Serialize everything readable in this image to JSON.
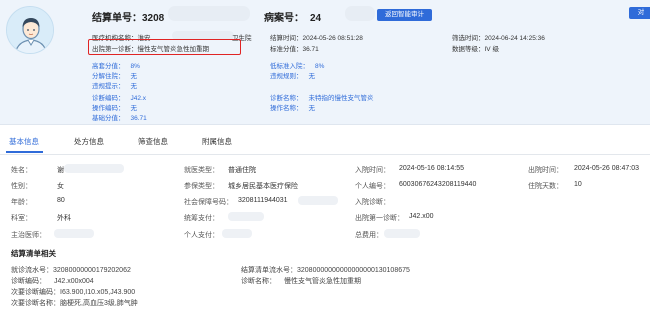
{
  "header": {
    "settle_no_label": "结算单号：",
    "settle_no_value": "3208",
    "case_no_label": "病案号：",
    "case_no_value": "24",
    "return_button": "返回智能审计",
    "right_button_fragment": "对",
    "institution_label": "医疗机构名称：",
    "institution_value": "淮安",
    "institution_suffix": "卫生院",
    "settle_time_label": "结算时间：",
    "settle_time_value": "2024-05-26 08:51:28",
    "filter_time_label": "筛选时间：",
    "filter_time_value": "2024-06-24 14:25:36",
    "discharge_diag_label": "出院第一诊断：",
    "discharge_diag_value": "慢性支气管炎急性加重期",
    "std_score_label": "标准分值：",
    "std_score_value": "36.71",
    "data_level_label": "数据等级：",
    "data_level_value": "IV 级",
    "high_score_label": "高套分值：",
    "high_score_value": "8%",
    "low_standard_label": "低标准入院：",
    "low_standard_value": "8%",
    "split_label": "分解住院：",
    "split_value": "无",
    "violation_label": "违规规则：",
    "violation_value": "无",
    "violation_hint_label": "违规提示：",
    "violation_hint_value": "无",
    "diag_code_label": "诊断编码：",
    "diag_code_value": "J42.x",
    "diag_name_label": "诊断名称：",
    "diag_name_value": "未特指的慢性支气管炎",
    "op_code_label": "操作编码：",
    "op_code_value": "无",
    "op_name_label": "操作名称：",
    "op_name_value": "无",
    "base_score_label": "基础分值：",
    "base_score_value": "36.71"
  },
  "tabs": [
    "基本信息",
    "处方信息",
    "筛查信息",
    "附属信息"
  ],
  "basic": {
    "name_label": "姓名：",
    "name_value": "谢",
    "visit_type_label": "就医类型：",
    "visit_type_value": "普通住院",
    "admit_time_label": "入院时间：",
    "admit_time_value": "2024-05-16 08:14:55",
    "discharge_time_label": "出院时间：",
    "discharge_time_value": "2024-05-26 08:47:03",
    "gender_label": "性别：",
    "gender_value": "女",
    "insurance_type_label": "参保类型：",
    "insurance_type_value": "城乡居民基本医疗保险",
    "personal_no_label": "个人编号：",
    "personal_no_value": "60030676243208119440",
    "stay_days_label": "住院天数：",
    "stay_days_value": "10",
    "age_label": "年龄：",
    "age_value": "80",
    "ss_card_label": "社会保障号码：",
    "ss_card_value": "3208111944031",
    "admit_diag_label": "入院诊断：",
    "admit_diag_value": "",
    "dept_label": "科室：",
    "dept_value": "外科",
    "pool_pay_label": "统筹支付：",
    "pool_pay_value": "",
    "discharge_first_label": "出院第一诊断：",
    "discharge_first_value": "J42.x00",
    "doctor_label": "主治医师：",
    "doctor_value": "",
    "self_pay_label": "个人支付：",
    "self_pay_value": "",
    "total_cost_label": "总费用：",
    "total_cost_value": ""
  },
  "settlement": {
    "section_title": "结算清单相关",
    "running_no_label": "就诊流水号：",
    "running_no_value": "32080000000179202062",
    "list_running_label": "结算清单流水号：",
    "list_running_value": "32080000000000000000130108675",
    "diag_code_label": "诊断编码：",
    "diag_code_value": "J42.x00x004",
    "diag_name_label": "诊断名称：",
    "diag_name_value": "慢性支气管炎急性加重期",
    "sub_diag_code_label": "次要诊断编码：",
    "sub_diag_code_value": "I63.900,I10.x05,J43.900",
    "sub_diag_name_label": "次要诊断名称：",
    "sub_diag_name_value": "脑梗死,高血压3级,肺气肿"
  },
  "colors": {
    "accent": "#2f6bd9",
    "highlight": "#e02424",
    "header_bg": "#eef4fb"
  }
}
